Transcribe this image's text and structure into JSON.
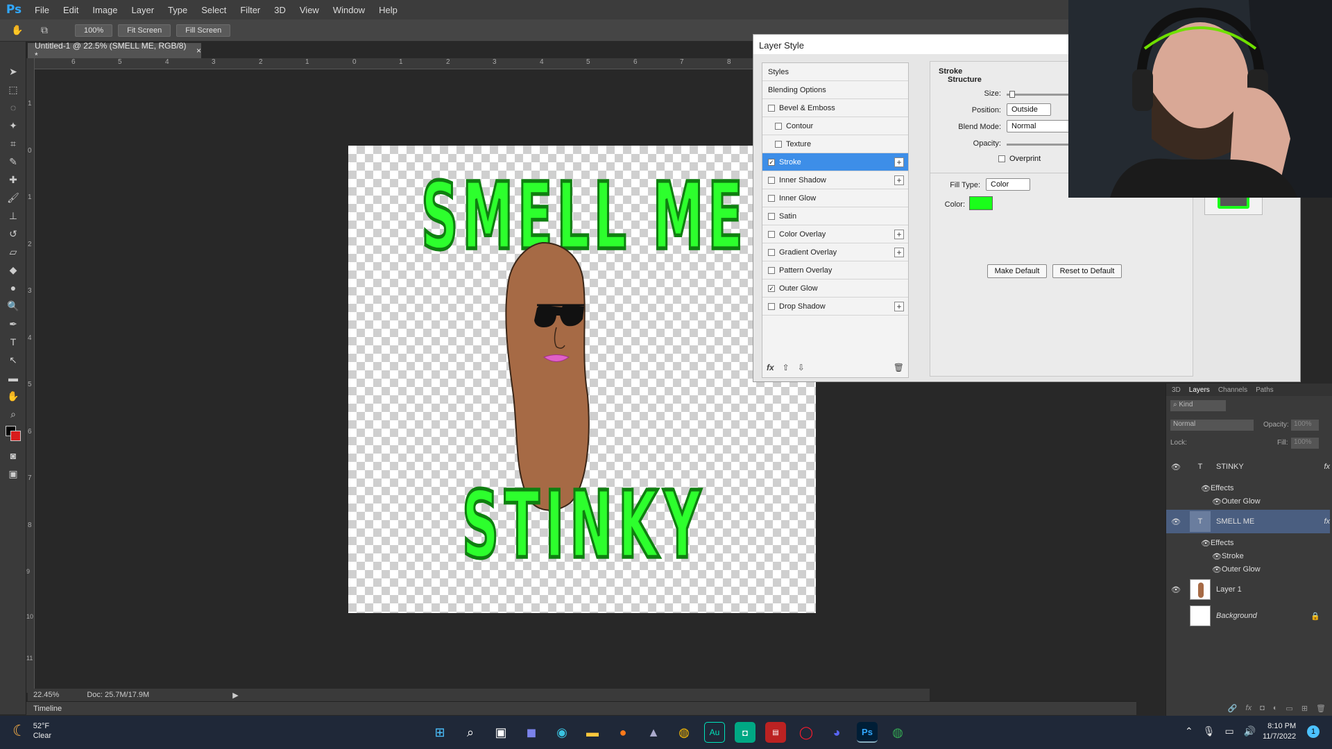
{
  "menubar": {
    "logo": "Ps",
    "items": [
      "File",
      "Edit",
      "Image",
      "Layer",
      "Type",
      "Select",
      "Filter",
      "3D",
      "View",
      "Window",
      "Help"
    ]
  },
  "options": {
    "zoom_btn": "100%",
    "fit_btn": "Fit Screen",
    "fill_btn": "Fill Screen"
  },
  "document": {
    "tab_title": "Untitled-1 @ 22.5% (SMELL ME, RGB/8) *",
    "close": "×",
    "ruler_h": [
      "6",
      "5",
      "4",
      "3",
      "2",
      "1",
      "0",
      "1",
      "2",
      "3",
      "4",
      "5",
      "6",
      "7",
      "8"
    ],
    "ruler_v": [
      "1",
      "0",
      "1",
      "2",
      "3",
      "4",
      "5",
      "6",
      "7",
      "8",
      "9",
      "10",
      "11"
    ]
  },
  "artwork": {
    "top_text": "SMELL ME",
    "bottom_text": "STINKY"
  },
  "status": {
    "zoom": "22.45%",
    "doc": "Doc: 25.7M/17.9M"
  },
  "timeline": {
    "label": "Timeline"
  },
  "dialog": {
    "title": "Layer Style",
    "styles_header": "Styles",
    "blending": "Blending Options",
    "items": [
      {
        "label": "Bevel & Emboss",
        "checked": false,
        "plus": false,
        "indent": false
      },
      {
        "label": "Contour",
        "checked": false,
        "plus": false,
        "indent": true
      },
      {
        "label": "Texture",
        "checked": false,
        "plus": false,
        "indent": true
      },
      {
        "label": "Stroke",
        "checked": true,
        "plus": true,
        "indent": false,
        "selected": true
      },
      {
        "label": "Inner Shadow",
        "checked": false,
        "plus": true,
        "indent": false
      },
      {
        "label": "Inner Glow",
        "checked": false,
        "plus": false,
        "indent": false
      },
      {
        "label": "Satin",
        "checked": false,
        "plus": false,
        "indent": false
      },
      {
        "label": "Color Overlay",
        "checked": false,
        "plus": true,
        "indent": false
      },
      {
        "label": "Gradient Overlay",
        "checked": false,
        "plus": true,
        "indent": false
      },
      {
        "label": "Pattern Overlay",
        "checked": false,
        "plus": false,
        "indent": false
      },
      {
        "label": "Outer Glow",
        "checked": true,
        "plus": false,
        "indent": false
      },
      {
        "label": "Drop Shadow",
        "checked": false,
        "plus": true,
        "indent": false
      }
    ],
    "footer_fx": "fx",
    "section_title": "Stroke",
    "structure": "Structure",
    "size_label": "Size:",
    "position_label": "Position:",
    "position_value": "Outside",
    "blend_label": "Blend Mode:",
    "blend_value": "Normal",
    "opacity_label": "Opacity:",
    "overprint_label": "Overprint",
    "filltype_label": "Fill Type:",
    "filltype_value": "Color",
    "color_label": "Color:",
    "stroke_color": "#1aff1a",
    "make_default": "Make Default",
    "reset_default": "Reset to Default"
  },
  "layers": {
    "tabs": [
      "3D",
      "Layers",
      "Channels",
      "Paths"
    ],
    "kind": "Kind",
    "blend": "Normal",
    "opacity_label": "Opacity:",
    "opacity_value": "100%",
    "lock_label": "Lock:",
    "fill_label": "Fill:",
    "fill_value": "100%",
    "stinky": "STINKY",
    "effects1": "Effects",
    "outer_glow1": "Outer Glow",
    "smell_me": "SMELL ME",
    "effects2": "Effects",
    "stroke": "Stroke",
    "outer_glow2": "Outer Glow",
    "layer1": "Layer 1",
    "background": "Background"
  },
  "taskbar": {
    "temp": "52°F",
    "weather": "Clear",
    "time": "8:10 PM",
    "date": "11/7/2022",
    "notif": "1"
  }
}
